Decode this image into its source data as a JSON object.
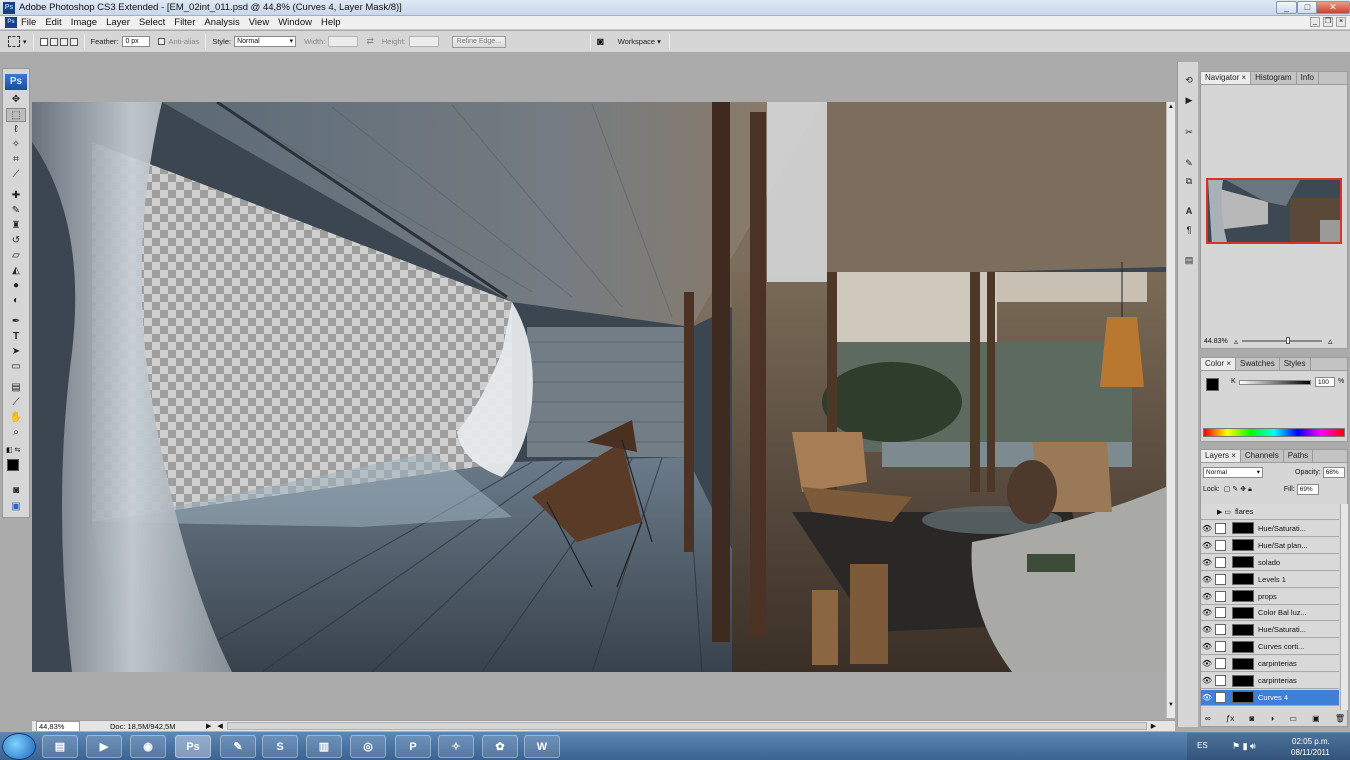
{
  "window": {
    "app_icon": "Ps",
    "title": "Adobe Photoshop CS3 Extended - [EM_02int_011.psd @ 44,8% (Curves 4, Layer Mask/8)]",
    "minimize": "_",
    "maximize": "□",
    "close": "✕"
  },
  "menu": {
    "items": [
      "File",
      "Edit",
      "Image",
      "Layer",
      "Select",
      "Filter",
      "Analysis",
      "View",
      "Window",
      "Help"
    ]
  },
  "options": {
    "feather_label": "Feather:",
    "feather_value": "0 px",
    "antialias_label": "Anti-alias",
    "style_label": "Style:",
    "style_value": "Normal",
    "width_label": "Width:",
    "height_label": "Height:",
    "refine_label": "Refine Edge...",
    "workspace_label": "Workspace ▾"
  },
  "toolbox": {
    "header": "Ps"
  },
  "status": {
    "zoom": "44,83%",
    "doc": "Doc: 18,5M/942,5M"
  },
  "navigator": {
    "tabs": [
      "Navigator ×",
      "Histogram",
      "Info"
    ],
    "zoom": "44.83%"
  },
  "color_panel": {
    "tabs": [
      "Color ×",
      "Swatches",
      "Styles"
    ],
    "channel_label": "K",
    "channel_value": "100",
    "percent": "%"
  },
  "layers": {
    "tabs": [
      "Layers ×",
      "Channels",
      "Paths"
    ],
    "blend_mode": "Normal",
    "opacity_label": "Opacity:",
    "opacity_value": "68%",
    "lock_label": "Lock:",
    "fill_label": "Fill:",
    "fill_value": "69%",
    "items": [
      {
        "name": "flares",
        "group": true
      },
      {
        "name": "Hue/Saturati..."
      },
      {
        "name": "Hue/Sat plan..."
      },
      {
        "name": "solado"
      },
      {
        "name": "Levels 1"
      },
      {
        "name": "props"
      },
      {
        "name": "Color Bal luz..."
      },
      {
        "name": "Hue/Saturati..."
      },
      {
        "name": "Curves corti..."
      },
      {
        "name": "carpinterias"
      },
      {
        "name": "carpinterias"
      },
      {
        "name": "Curves 4",
        "selected": true
      }
    ]
  },
  "taskbar": {
    "apps": [
      "Explorer",
      "Media",
      "Firefox",
      "Photoshop",
      "SketchUp",
      "Skype",
      "WinRAR",
      "App",
      "Proxy",
      "Notes",
      "Network",
      "Word"
    ],
    "lang": "ES",
    "time": "02:05 p.m.",
    "date": "08/11/2011"
  },
  "colors": {
    "accent": "#3f7fd6",
    "panel_bg": "#d6d6d6",
    "canvas_bg": "#ababab",
    "taskbar": "#3b6391"
  }
}
